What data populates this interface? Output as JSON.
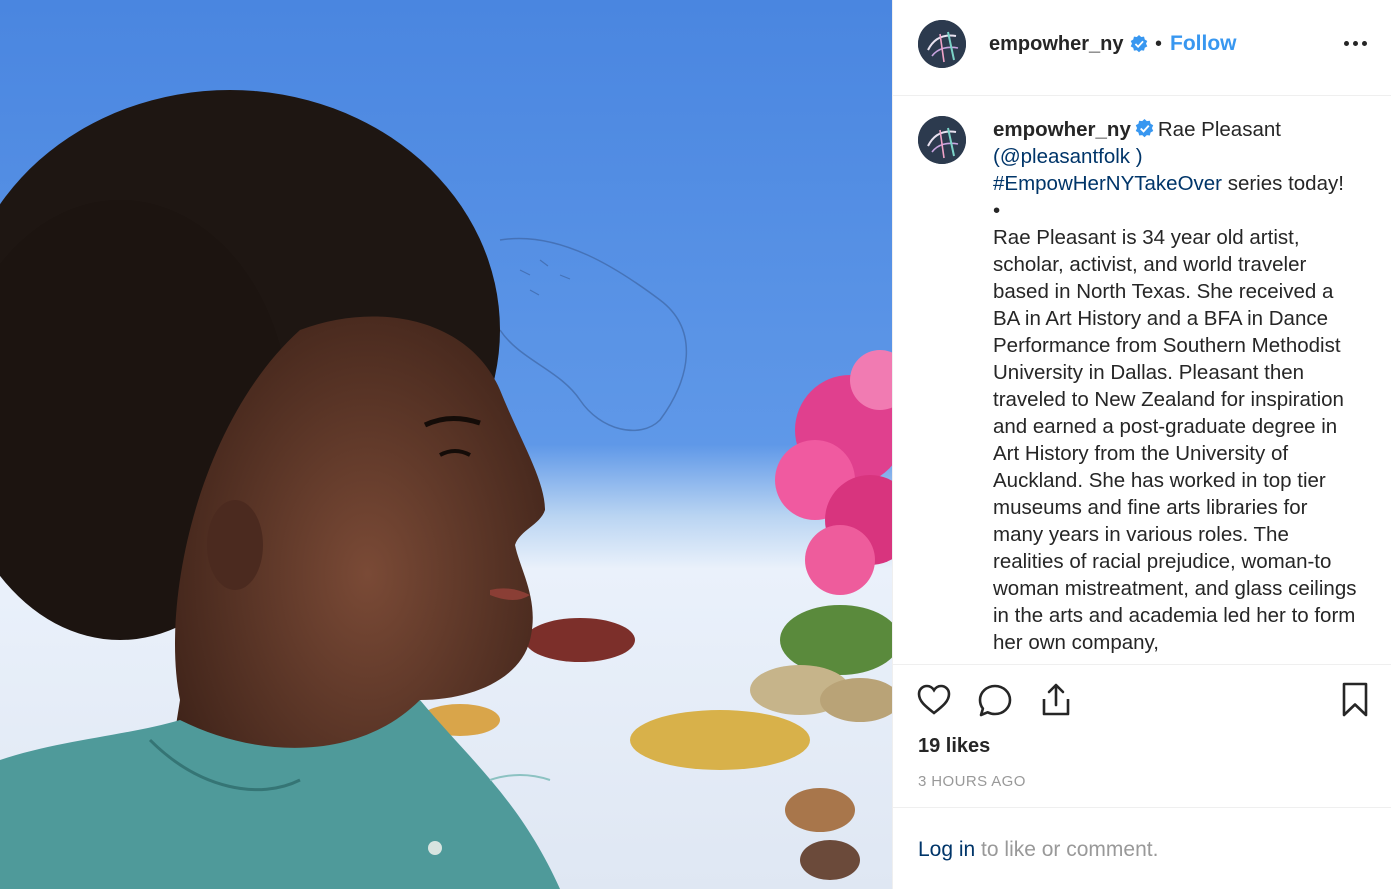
{
  "post": {
    "username": "empowher_ny",
    "separator": "•",
    "follow_label": "Follow",
    "more_label": "More options"
  },
  "caption": {
    "username": "empowher_ny",
    "intro": "Rae Pleasant",
    "mention": "(@pleasantfolk )",
    "hashtag": "#EmpowHerNYTakeOver",
    "hashtag_suffix": " series today!",
    "bullet": "•",
    "body": "Rae Pleasant is 34 year old artist, scholar, activist, and world traveler based in North Texas. She received a BA in Art History and a BFA in Dance Performance from Southern Methodist University in Dallas. Pleasant then traveled to New Zealand for inspiration and earned a post-graduate degree in Art History from the University of Auckland. She has worked in top tier museums and fine arts libraries for many years in various roles. The realities of racial prejudice, woman-to woman mistreatment, and glass ceilings in the arts and academia led her to form her own company,"
  },
  "stats": {
    "likes": "19 likes",
    "time": "3 HOURS AGO"
  },
  "footer": {
    "login_label": "Log in",
    "rest": " to like or comment."
  },
  "colors": {
    "accent": "#3897f0",
    "link": "#003569",
    "muted": "#999999",
    "text": "#262626"
  },
  "icons": {
    "like": "heart-icon",
    "comment": "comment-icon",
    "share": "share-icon",
    "save": "bookmark-icon",
    "more": "more-dots-icon",
    "verified": "verified-badge-icon"
  }
}
